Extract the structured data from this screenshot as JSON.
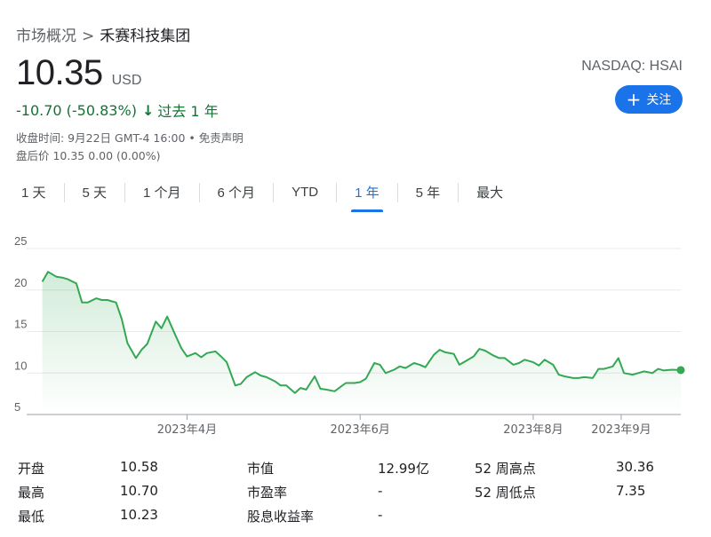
{
  "breadcrumb": {
    "root": "市场概况",
    "separator": ">",
    "current": "禾赛科技集团"
  },
  "quote": {
    "price": "10.35",
    "currency": "USD",
    "change": "-10.70 (-50.83%)",
    "arrow": "↓",
    "period": "过去 1 年",
    "close_time": "收盘时间: 9月22日 GMT-4 16:00 • 免责声明",
    "after_hours": "盘后价 10.35 0.00 (0.00%)",
    "exchange": "NASDAQ: HSAI",
    "follow_label": "关注",
    "change_color": "#137333"
  },
  "tabs": [
    {
      "label": "1 天",
      "active": false
    },
    {
      "label": "5 天",
      "active": false
    },
    {
      "label": "1 个月",
      "active": false
    },
    {
      "label": "6 个月",
      "active": false
    },
    {
      "label": "YTD",
      "active": false
    },
    {
      "label": "1 年",
      "active": true
    },
    {
      "label": "5 年",
      "active": false
    },
    {
      "label": "最大",
      "active": false
    }
  ],
  "chart_data": {
    "type": "area",
    "line_color": "#34a853",
    "ylim": [
      5,
      25
    ],
    "yticks": [
      5,
      10,
      15,
      20,
      25
    ],
    "xlim": [
      "2023-02-06",
      "2023-09-22"
    ],
    "xticks": [
      {
        "date": "2023-04-01",
        "label": "2023年4月"
      },
      {
        "date": "2023-06-01",
        "label": "2023年6月"
      },
      {
        "date": "2023-08-01",
        "label": "2023年8月"
      },
      {
        "date": "2023-09-01",
        "label": "2023年9月"
      }
    ],
    "grid": true,
    "x": [
      "2023-02-09",
      "2023-02-11",
      "2023-02-14",
      "2023-02-16",
      "2023-02-18",
      "2023-02-21",
      "2023-02-23",
      "2023-02-25",
      "2023-02-28",
      "2023-03-02",
      "2023-03-04",
      "2023-03-07",
      "2023-03-09",
      "2023-03-11",
      "2023-03-14",
      "2023-03-16",
      "2023-03-18",
      "2023-03-21",
      "2023-03-23",
      "2023-03-25",
      "2023-03-28",
      "2023-03-30",
      "2023-04-01",
      "2023-04-04",
      "2023-04-06",
      "2023-04-08",
      "2023-04-11",
      "2023-04-13",
      "2023-04-15",
      "2023-04-18",
      "2023-04-20",
      "2023-04-22",
      "2023-04-25",
      "2023-04-27",
      "2023-04-29",
      "2023-05-02",
      "2023-05-04",
      "2023-05-06",
      "2023-05-09",
      "2023-05-11",
      "2023-05-13",
      "2023-05-16",
      "2023-05-18",
      "2023-05-20",
      "2023-05-23",
      "2023-05-25",
      "2023-05-27",
      "2023-05-30",
      "2023-06-01",
      "2023-06-03",
      "2023-06-06",
      "2023-06-08",
      "2023-06-10",
      "2023-06-13",
      "2023-06-15",
      "2023-06-17",
      "2023-06-20",
      "2023-06-22",
      "2023-06-24",
      "2023-06-27",
      "2023-06-29",
      "2023-07-01",
      "2023-07-04",
      "2023-07-06",
      "2023-07-08",
      "2023-07-11",
      "2023-07-13",
      "2023-07-15",
      "2023-07-18",
      "2023-07-20",
      "2023-07-22",
      "2023-07-25",
      "2023-07-27",
      "2023-07-29",
      "2023-08-01",
      "2023-08-03",
      "2023-08-05",
      "2023-08-08",
      "2023-08-10",
      "2023-08-12",
      "2023-08-15",
      "2023-08-17",
      "2023-08-19",
      "2023-08-22",
      "2023-08-24",
      "2023-08-26",
      "2023-08-29",
      "2023-08-31",
      "2023-09-02",
      "2023-09-05",
      "2023-09-07",
      "2023-09-09",
      "2023-09-12",
      "2023-09-14",
      "2023-09-16",
      "2023-09-19",
      "2023-09-22"
    ],
    "values": [
      21.0,
      22.2,
      21.6,
      21.5,
      21.3,
      20.8,
      18.5,
      18.5,
      19.0,
      18.8,
      18.8,
      18.5,
      16.5,
      13.6,
      11.8,
      12.8,
      13.5,
      16.2,
      15.4,
      16.8,
      14.5,
      13.0,
      12.0,
      12.4,
      11.9,
      12.4,
      12.6,
      12.0,
      11.3,
      8.5,
      8.7,
      9.5,
      10.1,
      9.7,
      9.5,
      9.0,
      8.5,
      8.5,
      7.6,
      8.2,
      8.0,
      9.6,
      8.1,
      8.0,
      7.8,
      8.3,
      8.8,
      8.8,
      8.9,
      9.3,
      11.2,
      11.0,
      10.0,
      10.4,
      10.8,
      10.6,
      11.2,
      11.0,
      10.7,
      12.2,
      12.8,
      12.5,
      12.3,
      11.0,
      11.4,
      12.0,
      12.9,
      12.7,
      12.1,
      11.8,
      11.8,
      11.0,
      11.2,
      11.6,
      11.3,
      10.9,
      11.6,
      11.0,
      9.8,
      9.6,
      9.4,
      9.4,
      9.5,
      9.4,
      10.5,
      10.5,
      10.8,
      11.8,
      10.0,
      9.8,
      10.0,
      10.2,
      10.0,
      10.5,
      10.3,
      10.4,
      10.35
    ]
  },
  "stats": [
    {
      "label": "开盘",
      "value": "10.58"
    },
    {
      "label": "最高",
      "value": "10.70"
    },
    {
      "label": "最低",
      "value": "10.23"
    },
    {
      "label": "市值",
      "value": "12.99亿"
    },
    {
      "label": "市盈率",
      "value": "-"
    },
    {
      "label": "股息收益率",
      "value": "-"
    },
    {
      "label": "52 周高点",
      "value": "30.36"
    },
    {
      "label": "52 周低点",
      "value": "7.35"
    }
  ]
}
